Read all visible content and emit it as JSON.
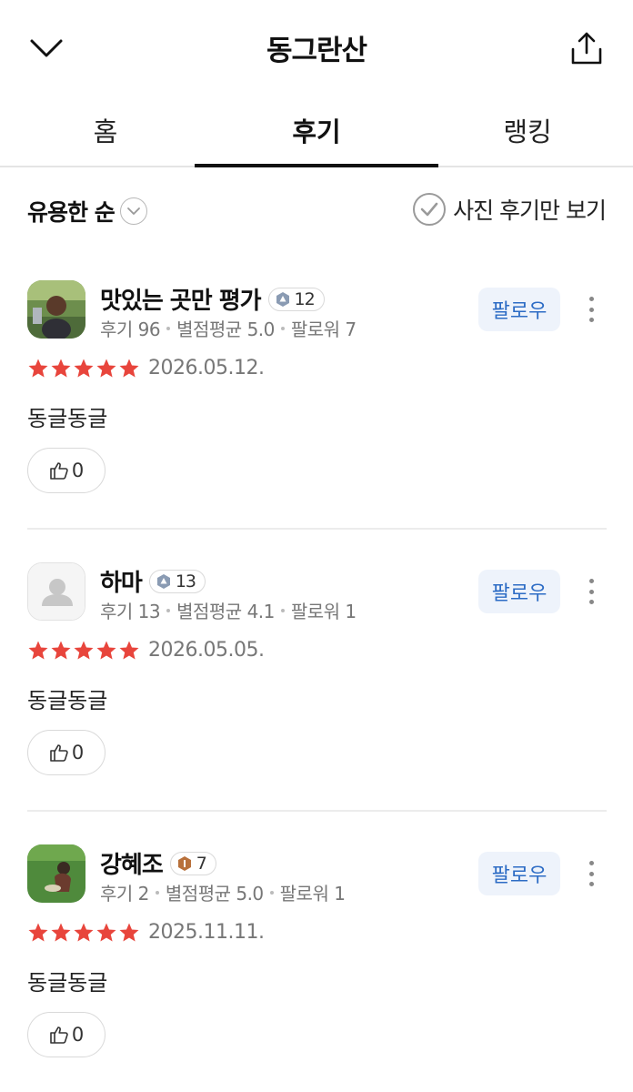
{
  "header": {
    "title": "동그란산",
    "back_icon": "chevron-down-icon",
    "share_icon": "share-icon"
  },
  "tabs": [
    {
      "label": "홈",
      "active": false
    },
    {
      "label": "후기",
      "active": true
    },
    {
      "label": "랭킹",
      "active": false
    }
  ],
  "filters": {
    "sort_label": "유용한 순",
    "photo_only_label": "사진 후기만 보기"
  },
  "colors": {
    "star": "#e8453c",
    "follow_text": "#2d6cc5",
    "follow_bg": "#eef3fb"
  },
  "reviews": [
    {
      "nickname": "맛있는 곳만 평가",
      "level": "12",
      "level_color": "#8a9bb3",
      "avatar": "photo-avatar",
      "stats": {
        "reviews": "후기 96",
        "avg": "별점평균 5.0",
        "followers": "팔로워 7"
      },
      "follow_label": "팔로우",
      "rating": 5,
      "date": "2026.05.12.",
      "text": "동글동글",
      "likes": "0"
    },
    {
      "nickname": "하마",
      "level": "13",
      "level_color": "#8a9bb3",
      "avatar": "default-avatar",
      "stats": {
        "reviews": "후기 13",
        "avg": "별점평균 4.1",
        "followers": "팔로워 1"
      },
      "follow_label": "팔로우",
      "rating": 5,
      "date": "2026.05.05.",
      "text": "동글동글",
      "likes": "0"
    },
    {
      "nickname": "강혜조",
      "level": "7",
      "level_color": "#b8703a",
      "avatar": "photo-avatar",
      "stats": {
        "reviews": "후기 2",
        "avg": "별점평균 5.0",
        "followers": "팔로워 1"
      },
      "follow_label": "팔로우",
      "rating": 5,
      "date": "2025.11.11.",
      "text": "동글동글",
      "likes": "0"
    }
  ]
}
